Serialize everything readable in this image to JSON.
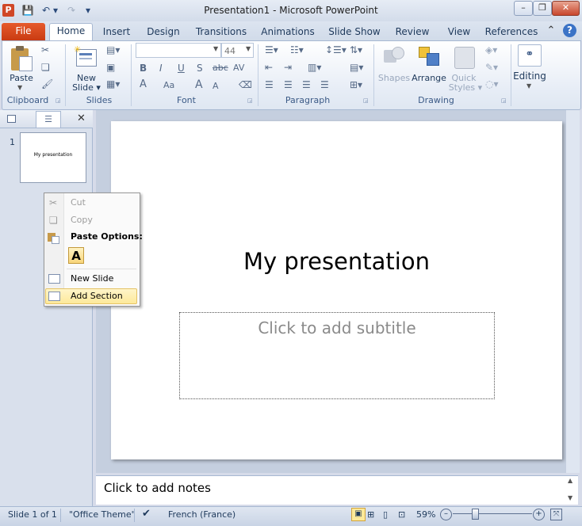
{
  "window": {
    "title": "Presentation1  -  Microsoft PowerPoint",
    "minimize": "–",
    "restore": "❐",
    "close": "✕"
  },
  "qat": {
    "app_icon": "P",
    "save": "💾",
    "undo": "↶",
    "redo": "↷",
    "customize": "▾"
  },
  "tabs": {
    "file": "File",
    "items": [
      "Home",
      "Insert",
      "Design",
      "Transitions",
      "Animations",
      "Slide Show",
      "Review",
      "View",
      "References"
    ],
    "minimize_ribbon": "⌃",
    "help": "?"
  },
  "ribbon": {
    "clipboard": {
      "label": "Clipboard",
      "paste": "Paste"
    },
    "slides": {
      "label": "Slides",
      "new_slide_line1": "New",
      "new_slide_line2": "Slide ▾"
    },
    "font": {
      "label": "Font",
      "font_name": "",
      "font_size": "44",
      "bold": "B",
      "italic": "I",
      "underline": "U",
      "strike": "S",
      "shadow": "abc",
      "spacing": "AV",
      "color_a": "A",
      "case": "Aa",
      "grow": "A",
      "shrink": "A"
    },
    "paragraph": {
      "label": "Paragraph"
    },
    "drawing": {
      "label": "Drawing",
      "shapes": "Shapes",
      "arrange": "Arrange",
      "quick_styles_line1": "Quick",
      "quick_styles_line2": "Styles ▾"
    },
    "editing": {
      "label": "Editing"
    }
  },
  "slides_pane": {
    "thumb_number": "1",
    "thumb_text": "My presentation"
  },
  "slide": {
    "title": "My presentation",
    "subtitle_placeholder": "Click to add subtitle"
  },
  "notes": {
    "placeholder": "Click to add notes"
  },
  "status": {
    "slide_counter": "Slide 1 of 1",
    "theme": "\"Office Theme\"",
    "language": "French (France)",
    "zoom": "59%",
    "zoom_out": "–",
    "zoom_in": "+"
  },
  "context_menu": {
    "items": [
      {
        "label": "Cut",
        "enabled": false
      },
      {
        "label": "Copy",
        "enabled": false
      },
      {
        "label": "Paste Options:",
        "enabled": true
      },
      {
        "label": "New Slide",
        "enabled": true
      },
      {
        "label": "Add Section",
        "enabled": true,
        "highlighted": true
      }
    ],
    "paste_option_glyph": "A"
  }
}
